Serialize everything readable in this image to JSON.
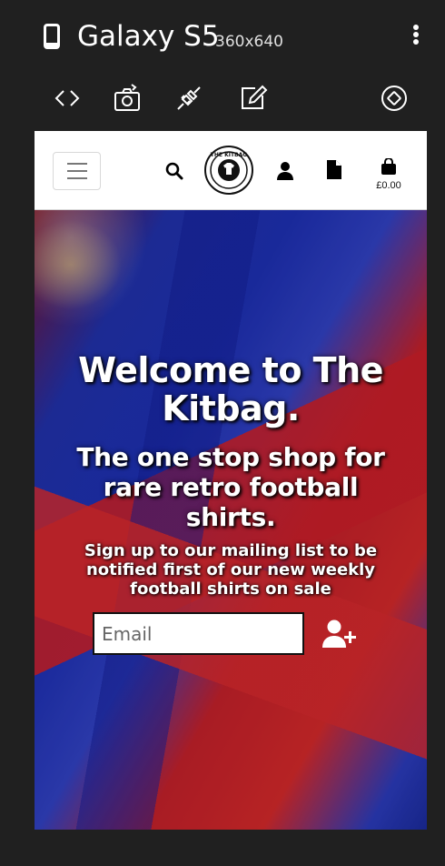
{
  "device": {
    "name": "Galaxy S5",
    "resolution": "360x640"
  },
  "toolbar": {
    "icons": [
      "code-icon",
      "camera-icon",
      "plug-icon",
      "edit-icon",
      "rotate-icon"
    ]
  },
  "site": {
    "basket_total": "£0.00",
    "logo_text": "THE KITBAG"
  },
  "hero": {
    "title": "Welcome to The Kitbag.",
    "subtitle": "The one stop shop for rare retro football shirts.",
    "signup_text": "Sign up to our mailing list to be notified first of our new weekly football shirts on sale",
    "email_placeholder": "Email"
  }
}
